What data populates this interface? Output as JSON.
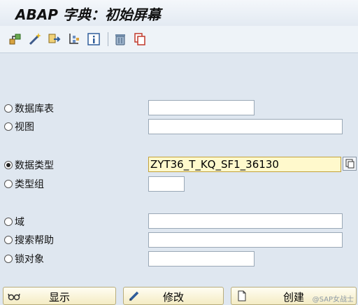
{
  "title": "ABAP 字典：初始屏幕",
  "toolbar": {
    "icons": [
      "other-object-icon",
      "magic-wand-icon",
      "transfer-icon",
      "where-used-icon",
      "info-icon",
      "delete-icon",
      "copy-icon"
    ]
  },
  "options": [
    {
      "label": "数据库表",
      "selected": false
    },
    {
      "label": "视图",
      "selected": false
    },
    {
      "label": "数据类型",
      "selected": true
    },
    {
      "label": "类型组",
      "selected": false
    },
    {
      "label": "域",
      "selected": false
    },
    {
      "label": "搜索帮助",
      "selected": false
    },
    {
      "label": "锁对象",
      "selected": false
    }
  ],
  "fields": {
    "data_type_value": "ZYT36_T_KQ_SF1_36130"
  },
  "buttons": {
    "display": "显示",
    "change": "修改",
    "create": "创建"
  },
  "watermark": "@SAP女战士",
  "colors": {
    "background": "#dfe7f0",
    "active_field": "#fff9cc",
    "focus_bracket": "#d04a2a"
  }
}
